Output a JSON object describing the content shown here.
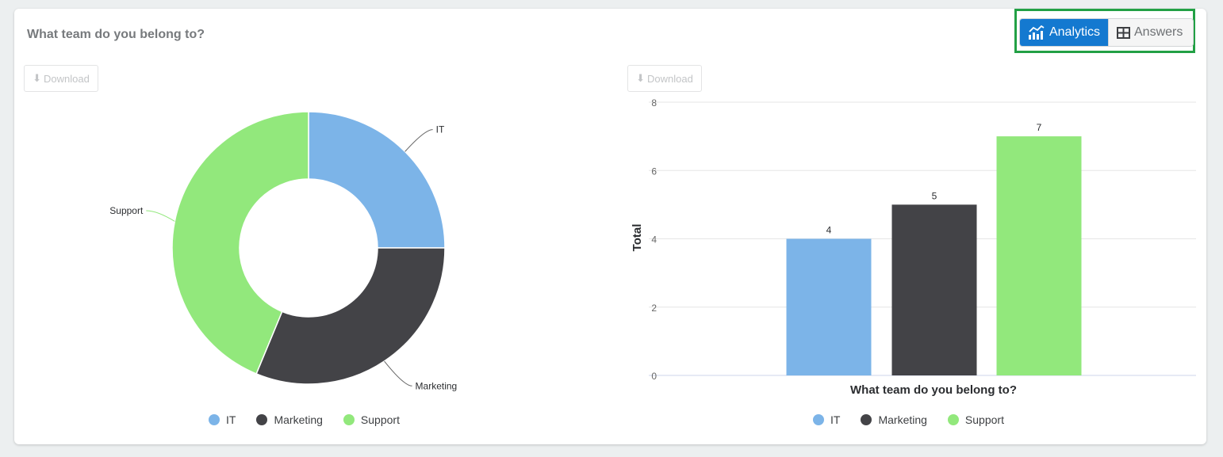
{
  "question": {
    "title": "What team do you belong to?"
  },
  "view_toggle": {
    "analytics_label": "Analytics",
    "analytics_icon": "bar-line-chart-icon",
    "answers_label": "Answers",
    "answers_icon": "table-grid-icon",
    "active": "Analytics",
    "active_color": "#1479d0",
    "highlight_color": "#22a045"
  },
  "download_buttons": [
    {
      "label": "Download",
      "icon": "download-arrow-icon"
    },
    {
      "label": "Download",
      "icon": "download-arrow-icon"
    }
  ],
  "chart_data": [
    {
      "type": "pie",
      "variant": "donut",
      "title": "",
      "categories": [
        "IT",
        "Marketing",
        "Support"
      ],
      "values": [
        4,
        5,
        7
      ],
      "colors": [
        "#7cb4e8",
        "#434347",
        "#92e87c"
      ],
      "slice_labels": [
        "IT",
        "Marketing",
        "Support"
      ],
      "legend": {
        "entries": [
          "IT",
          "Marketing",
          "Support"
        ],
        "placement": "bottom"
      }
    },
    {
      "type": "bar",
      "title": "",
      "categories": [
        "IT",
        "Marketing",
        "Support"
      ],
      "values": [
        4,
        5,
        7
      ],
      "data_labels": [
        "4",
        "5",
        "7"
      ],
      "colors": [
        "#7cb4e8",
        "#434347",
        "#92e87c"
      ],
      "xlabel": "What team do you belong to?",
      "ylabel": "Total",
      "ylim": [
        0,
        8
      ],
      "yticks": [
        "0",
        "2",
        "4",
        "6",
        "8"
      ],
      "grid": true,
      "legend": {
        "entries": [
          "IT",
          "Marketing",
          "Support"
        ],
        "placement": "bottom"
      }
    }
  ]
}
